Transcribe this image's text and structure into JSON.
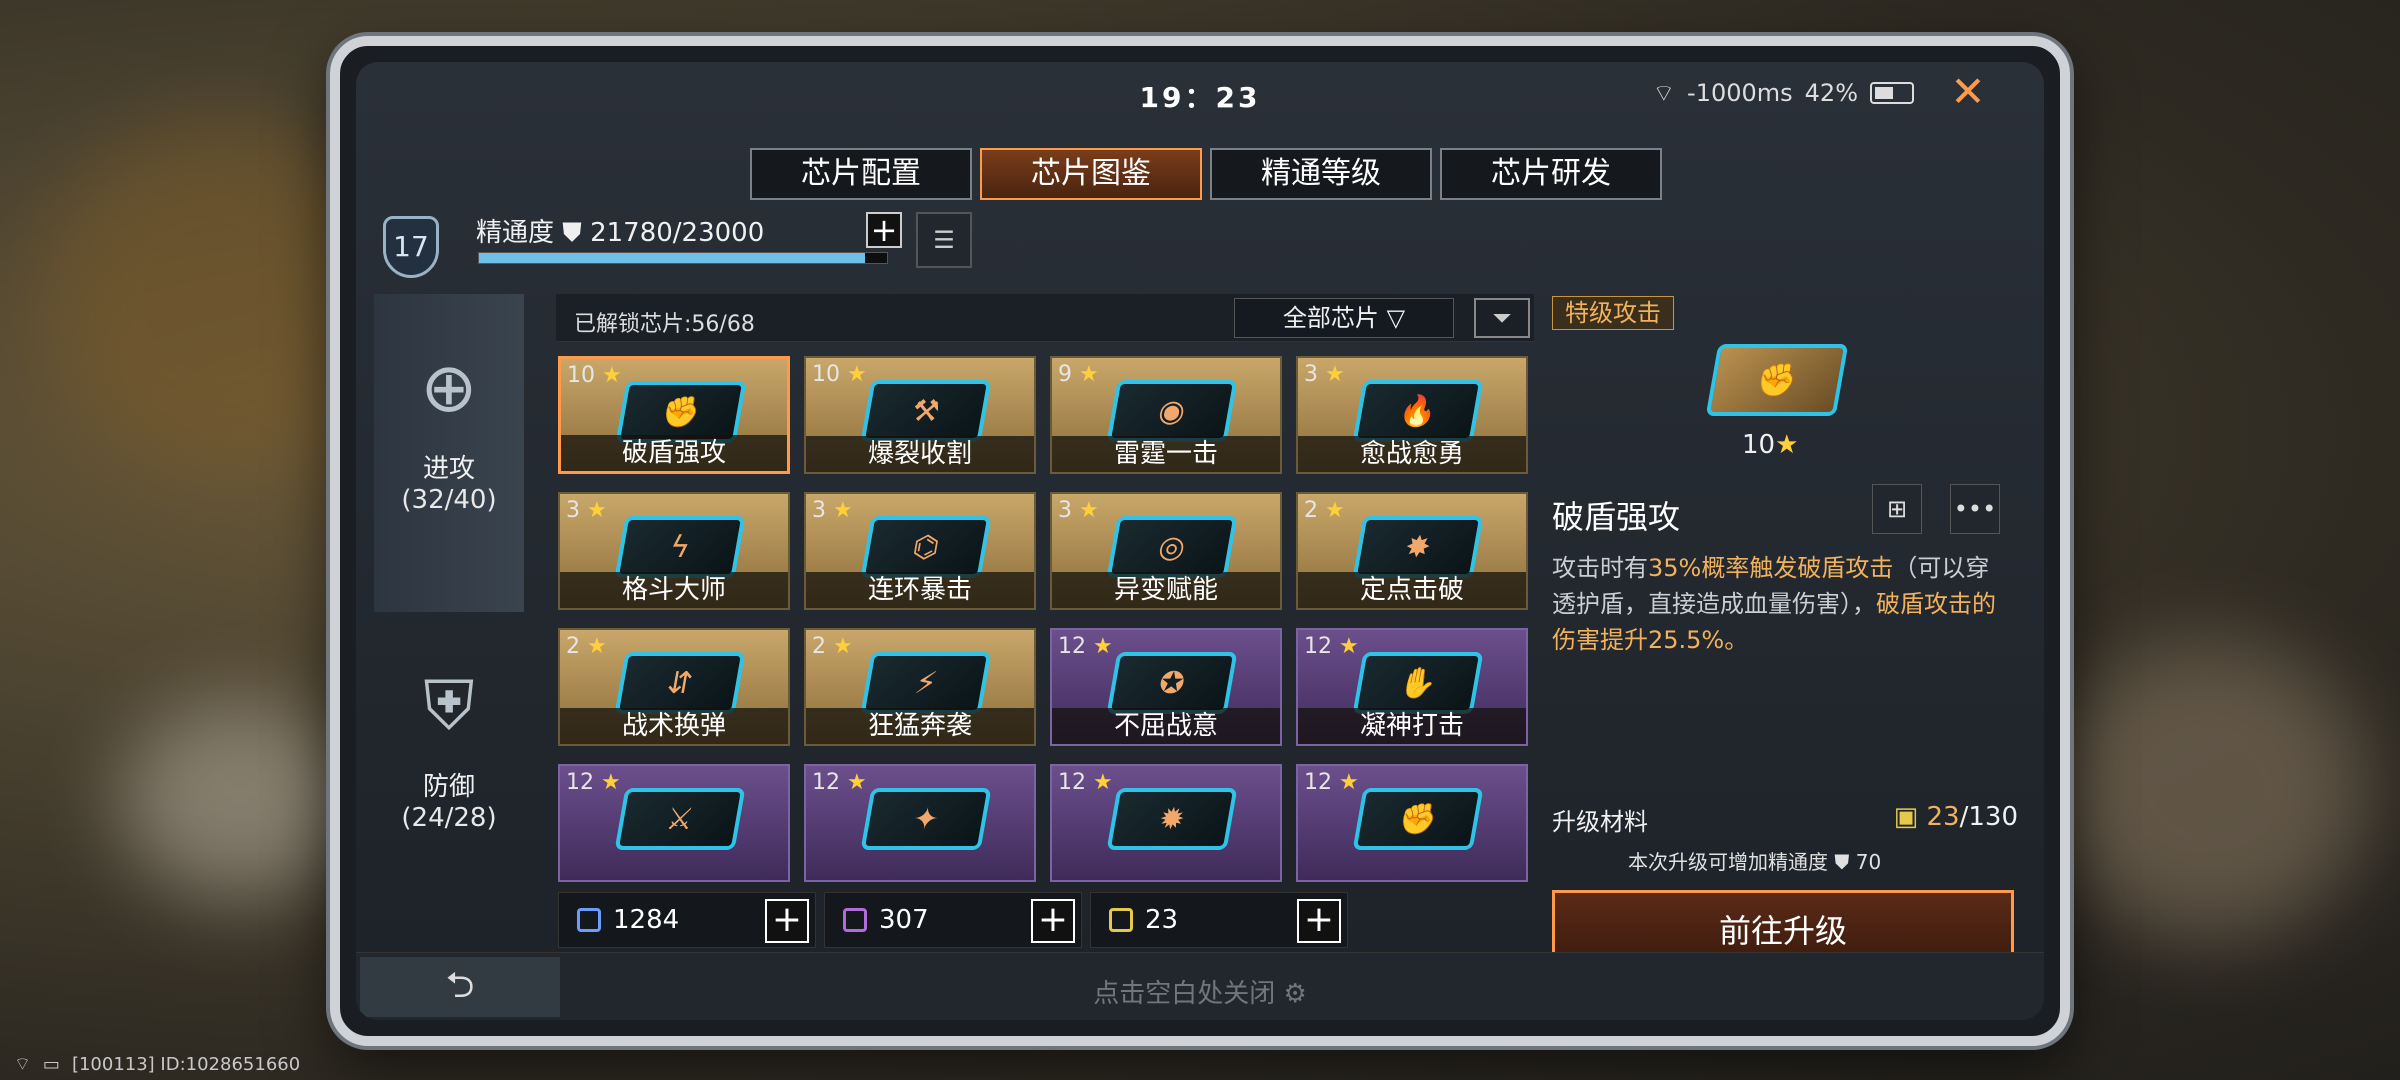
{
  "status": {
    "time": "19：23",
    "network": "-1000ms",
    "battery": "42%"
  },
  "tabs": [
    "芯片配置",
    "芯片图鉴",
    "精通等级",
    "芯片研发"
  ],
  "mastery": {
    "level": "17",
    "label": "精通度",
    "value": "21780/23000",
    "progress": 0.947
  },
  "side_tabs": [
    {
      "label": "进攻",
      "count": "(32/40)"
    },
    {
      "label": "防御",
      "count": "(24/28)"
    }
  ],
  "unlocked_text": "已解锁芯片:56/68",
  "filter_label": "全部芯片",
  "chips": [
    {
      "stars": "10",
      "name": "破盾强攻"
    },
    {
      "stars": "10",
      "name": "爆裂收割"
    },
    {
      "stars": "9",
      "name": "雷霆一击"
    },
    {
      "stars": "3",
      "name": "愈战愈勇"
    },
    {
      "stars": "3",
      "name": "格斗大师"
    },
    {
      "stars": "3",
      "name": "连环暴击"
    },
    {
      "stars": "3",
      "name": "异变赋能"
    },
    {
      "stars": "2",
      "name": "定点击破"
    },
    {
      "stars": "2",
      "name": "战术换弹"
    },
    {
      "stars": "2",
      "name": "狂猛奔袭"
    },
    {
      "stars": "12",
      "name": "不屈战意"
    },
    {
      "stars": "12",
      "name": "凝神打击"
    },
    {
      "stars": "12",
      "name": ""
    },
    {
      "stars": "12",
      "name": ""
    },
    {
      "stars": "12",
      "name": ""
    },
    {
      "stars": "12",
      "name": ""
    }
  ],
  "resources": [
    "1284",
    "307",
    "23"
  ],
  "detail": {
    "tag": "特级攻击",
    "stars": "10",
    "name": "破盾强攻",
    "desc_1": "攻击时有",
    "desc_hl1": "35%概率触发破盾攻击",
    "desc_2": "（可以穿透护盾，直接造成血量伤害），",
    "desc_hl2": "破盾攻击的伤害提升25.5%。",
    "material_label": "升级材料",
    "material_current": "23",
    "material_total": "/130",
    "note": "本次升级可增加精通度",
    "note_value": "70",
    "upgrade_button": "前往升级"
  },
  "tap_close": "点击空白处关闭",
  "bottom_id": "[100113] ID:1028651660"
}
